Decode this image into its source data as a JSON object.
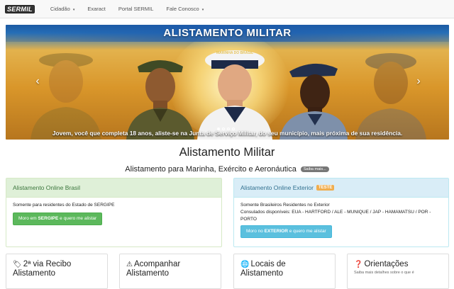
{
  "navbar": {
    "brand": "SERMIL",
    "items": [
      {
        "label": "Cidadão",
        "caret": "▾"
      },
      {
        "label": "Exaract",
        "caret": ""
      },
      {
        "label": "Portal SERMIL",
        "caret": ""
      },
      {
        "label": "Fale Conosco",
        "caret": "▾"
      }
    ]
  },
  "carousel": {
    "title": "ALISTAMENTO MILITAR",
    "cap_text": "MARINHA DO BRASIL",
    "caption": "Jovem, você que completa 18 anos, aliste-se na Junta de Serviço Militar, do seu município, mais próxima de sua residência.",
    "prev": "‹",
    "next": "›",
    "slides": 4,
    "active_slide": 1
  },
  "main": {
    "title": "Alistamento Militar",
    "subtitle": "Alistamento para Marinha, Exército e Aeronáutica",
    "more_badge": "Saiba mais..."
  },
  "panels": {
    "brasil": {
      "heading": "Alistamento Online Brasil",
      "text": "Somente para residentes do Estado de SERGIPE",
      "button_pre": "Moro em ",
      "button_strong": "SERGIPE",
      "button_post": " e quero me alistar"
    },
    "exterior": {
      "heading": "Alistamento Online Exterior",
      "badge": "TESTE",
      "text1": "Somente Brasileiros Residentes no Exterior",
      "text2": "Consulados disponíveis: EUA - HARTFORD / ALE - MUNIQUE / JAP - HAMAMATSU / POR - PORTO",
      "button_pre": "Moro no ",
      "button_strong": "EXTERIOR",
      "button_post": " e quero me alistar"
    }
  },
  "cards": [
    {
      "icon": "tag-icon",
      "glyph": "🏷",
      "title": "2ª via Recibo Alistamento",
      "sub": ""
    },
    {
      "icon": "warning-icon",
      "glyph": "⚠",
      "title": "Acompanhar Alistamento",
      "sub": ""
    },
    {
      "icon": "globe-icon",
      "glyph": "🌐",
      "title": "Locais de Alistamento",
      "sub": ""
    },
    {
      "icon": "question-icon",
      "glyph": "❓",
      "title": "Orientações",
      "sub": "Saiba mais detalhes sobre o que é"
    }
  ],
  "colors": {
    "panel_green_bg": "#dff0d8",
    "panel_blue_bg": "#d9edf7",
    "btn_green": "#5cb85c",
    "btn_blue": "#5bc0de",
    "teste_badge": "#f0ad4e"
  }
}
